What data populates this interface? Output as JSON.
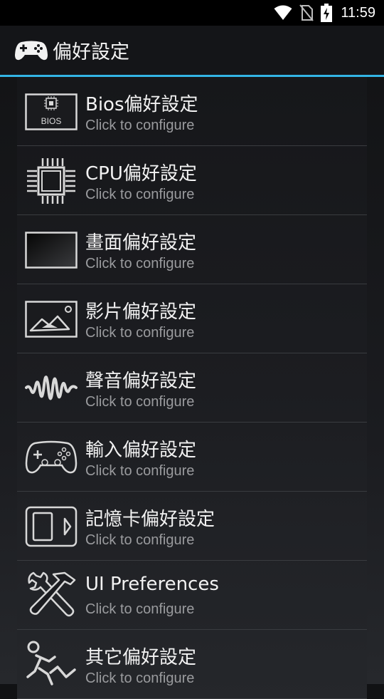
{
  "status_bar": {
    "time": "11:59",
    "icons": [
      "wifi-icon",
      "no-sim-icon",
      "battery-charging-icon"
    ]
  },
  "app_bar": {
    "icon": "gamepad-icon",
    "title": "偏好設定",
    "accent_color": "#33b5e5"
  },
  "items": [
    {
      "title": "Bios偏好設定",
      "subtitle": "Click to configure",
      "icon": "bios-chip-icon",
      "icon_label": "BIOS"
    },
    {
      "title": "CPU偏好設定",
      "subtitle": "Click to configure",
      "icon": "cpu-icon"
    },
    {
      "title": "畫面偏好設定",
      "subtitle": "Click to configure",
      "icon": "screen-icon"
    },
    {
      "title": "影片偏好設定",
      "subtitle": "Click to configure",
      "icon": "picture-icon"
    },
    {
      "title": "聲音偏好設定",
      "subtitle": "Click to configure",
      "icon": "sound-wave-icon"
    },
    {
      "title": "輸入偏好設定",
      "subtitle": "Click to configure",
      "icon": "gamepad-icon"
    },
    {
      "title": "記憶卡偏好設定",
      "subtitle": "Click to configure",
      "icon": "memory-card-icon"
    },
    {
      "title": "UI Preferences",
      "subtitle": "Click to configure",
      "icon": "tools-icon"
    },
    {
      "title": "其它偏好設定",
      "subtitle": "Click to configure",
      "icon": "misc-running-icon"
    }
  ]
}
